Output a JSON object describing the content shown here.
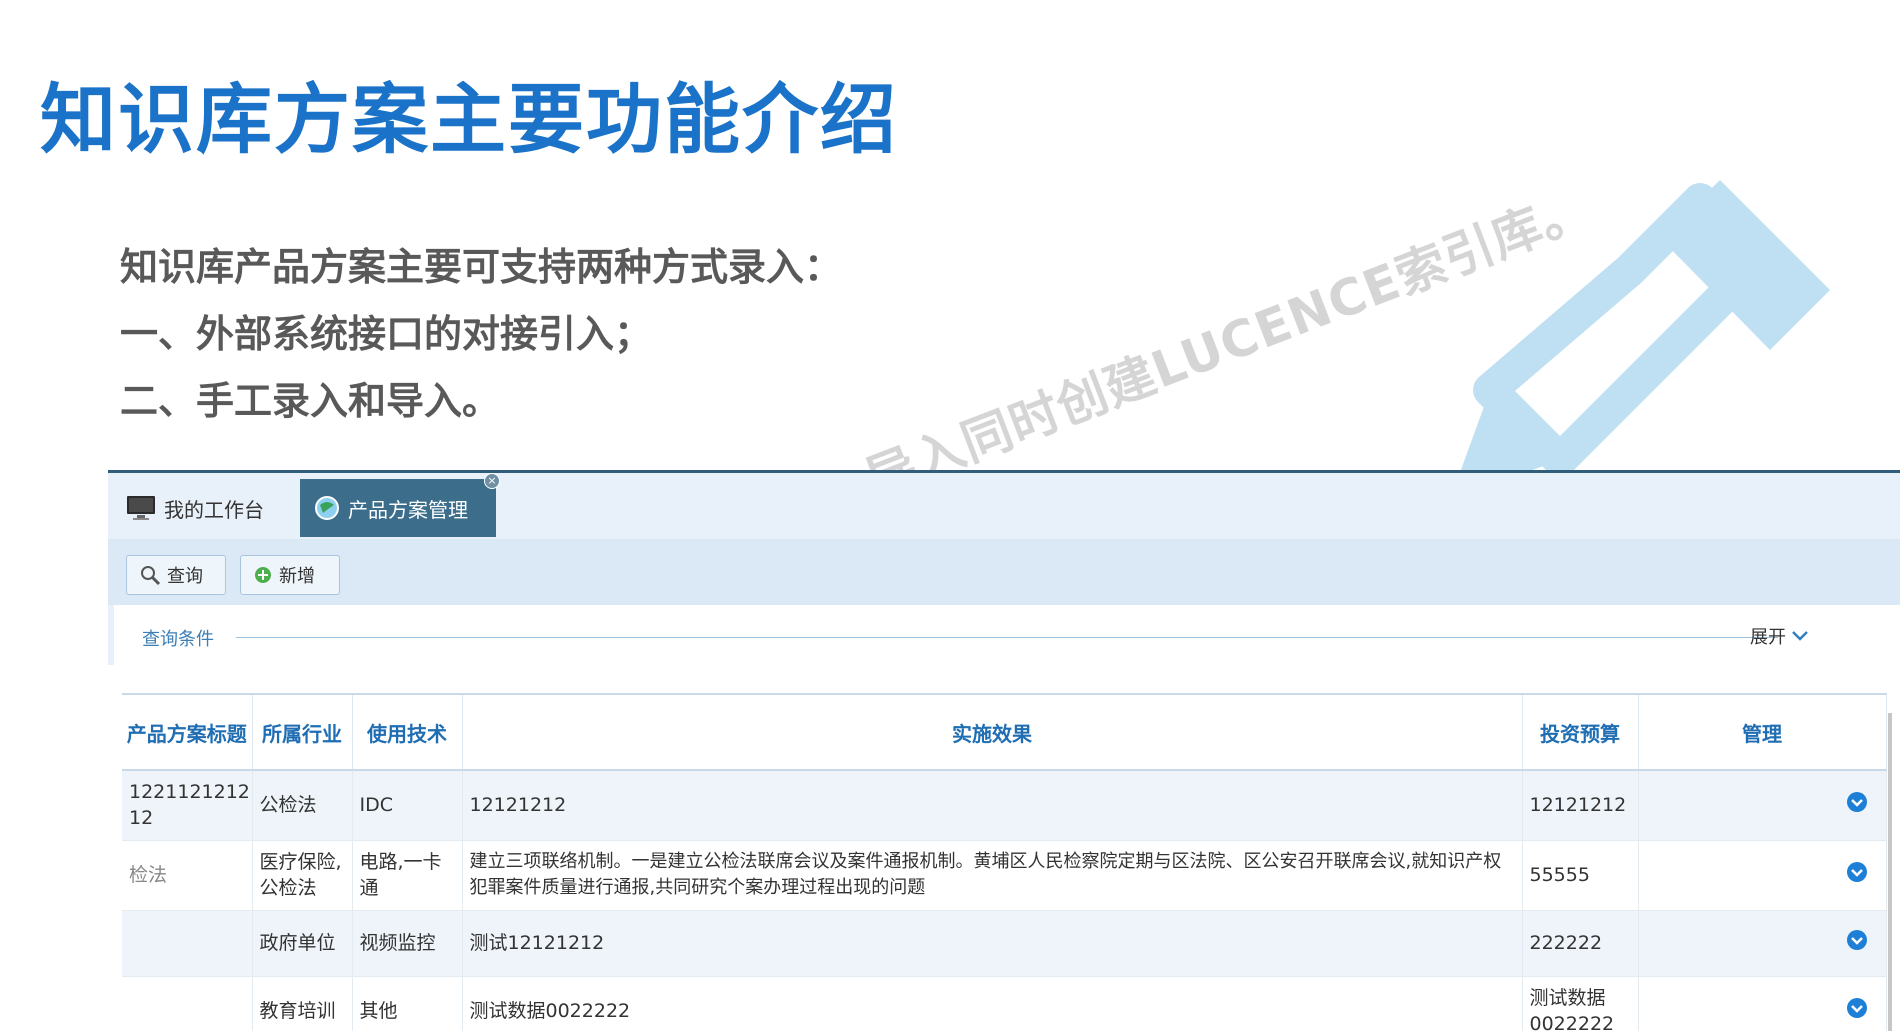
{
  "slide": {
    "title": "知识库方案主要功能介绍",
    "intro": [
      "知识库产品方案主要可支持两种方式录入：",
      "一、外部系统接口的对接引入；",
      "二、手工录入和导入。"
    ],
    "watermark": "导入同时创建LUCENCE索引库。"
  },
  "app": {
    "tabs": [
      {
        "label": "我的工作台",
        "icon": "monitor-icon",
        "active": false
      },
      {
        "label": "产品方案管理",
        "icon": "globe-icon",
        "active": true
      }
    ],
    "toolbar": {
      "search_label": "查询",
      "add_label": "新增"
    },
    "query": {
      "label": "查询条件",
      "expand_label": "展开"
    },
    "table": {
      "headers": [
        "产品方案标题",
        "所属行业",
        "使用技术",
        "实施效果",
        "投资预算",
        "管理"
      ],
      "rows": [
        {
          "title": "1221121212 12",
          "industry": "公检法",
          "tech": "IDC",
          "effect": "12121212",
          "budget": "12121212"
        },
        {
          "title": "检法",
          "industry": "医疗保险,公检法",
          "tech": "电路,一卡通",
          "effect": "建立三项联络机制。一是建立公检法联席会议及案件通报机制。黄埔区人民检察院定期与区法院、区公安召开联席会议,就知识产权犯罪案件质量进行通报,共同研究个案办理过程出现的问题",
          "budget": "55555"
        },
        {
          "title": "",
          "industry": "政府单位",
          "tech": "视频监控",
          "effect": "测试12121212",
          "budget": "222222"
        },
        {
          "title": "",
          "industry": "教育培训",
          "tech": "其他",
          "effect": "测试数据0022222",
          "budget": "测试数据0022222"
        }
      ]
    }
  },
  "colors": {
    "title_blue": "#1a73c8",
    "tab_active": "#3c6e8c",
    "header_blue": "#1f6db3",
    "pencil_blue": "#bfe0f3"
  }
}
